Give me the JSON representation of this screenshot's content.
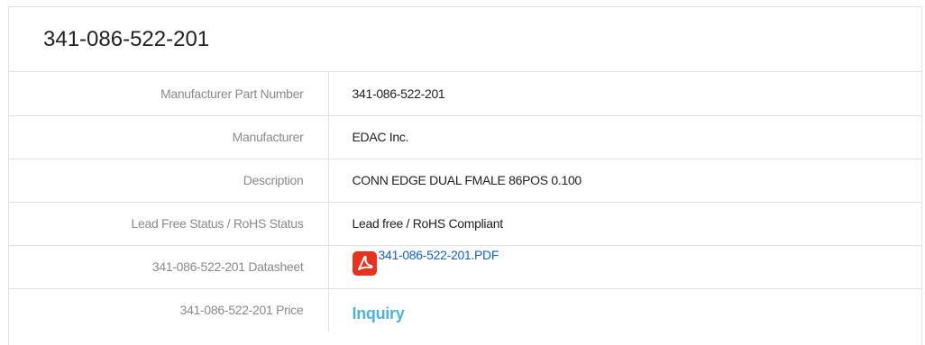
{
  "title": "341-086-522-201",
  "rows": [
    {
      "label": "Manufacturer Part Number",
      "value": "341-086-522-201"
    },
    {
      "label": "Manufacturer",
      "value": "EDAC Inc."
    },
    {
      "label": "Description",
      "value": "CONN EDGE DUAL FMALE 86POS 0.100"
    },
    {
      "label": "Lead Free Status / RoHS Status",
      "value": "Lead free / RoHS Compliant"
    },
    {
      "label": "341-086-522-201 Datasheet",
      "value": "341-086-522-201.PDF",
      "icon": "pdf-icon"
    },
    {
      "label": "341-086-522-201 Price",
      "value": "Inquiry"
    }
  ],
  "colors": {
    "pdf_icon": "#e53322",
    "link": "#1a5fb4",
    "inquiry": "#4fb3d9",
    "label": "#8a8a8a",
    "border": "#e2e2e2"
  }
}
